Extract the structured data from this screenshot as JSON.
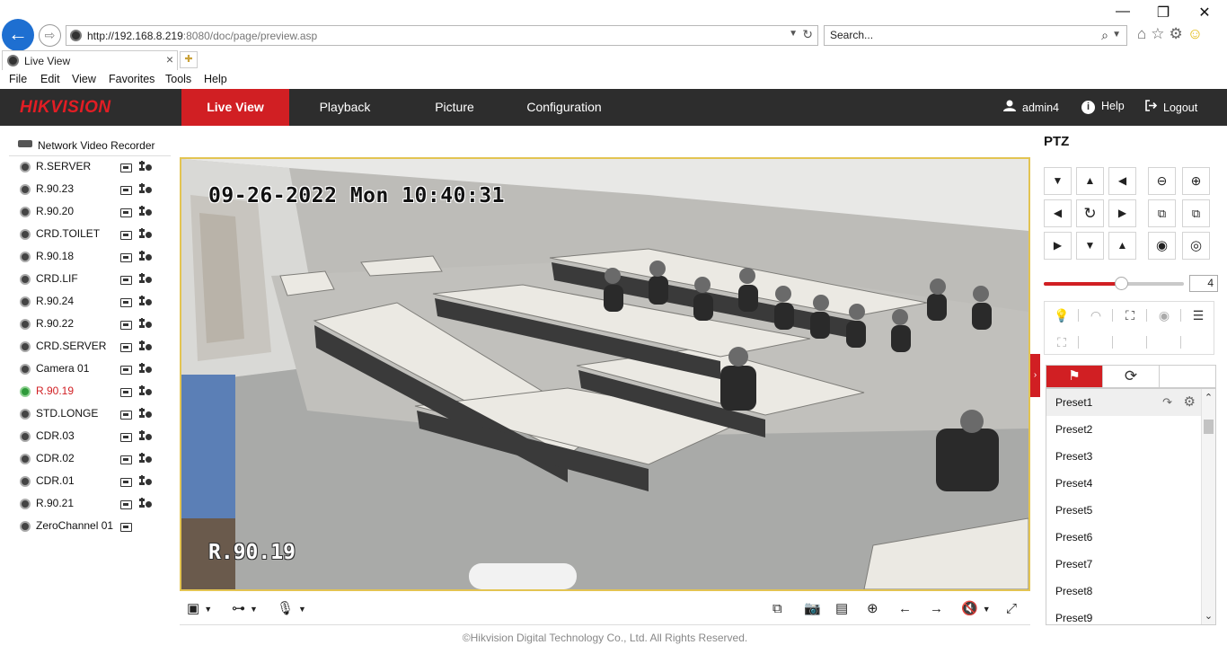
{
  "browser": {
    "window_controls": [
      "—",
      "❐",
      "✕"
    ],
    "url_host": "http://192.168.8.219",
    "url_rest": ":8080/doc/page/preview.asp",
    "search_placeholder": "Search...",
    "tab_title": "Live View",
    "menu": [
      "File",
      "Edit",
      "View",
      "Favorites",
      "Tools",
      "Help"
    ]
  },
  "app": {
    "logo": "HIKVISION",
    "nav": [
      "Live View",
      "Playback",
      "Picture",
      "Configuration"
    ],
    "user": "admin4",
    "help": "Help",
    "logout": "Logout"
  },
  "tree": {
    "root": "Network Video Recorder",
    "channels": [
      {
        "name": "R.SERVER",
        "ptz": true
      },
      {
        "name": "R.90.23",
        "ptz": true
      },
      {
        "name": "R.90.20",
        "ptz": true
      },
      {
        "name": "CRD.TOILET",
        "ptz": true
      },
      {
        "name": "R.90.18",
        "ptz": true
      },
      {
        "name": "CRD.LIF",
        "ptz": true
      },
      {
        "name": "R.90.24",
        "ptz": true
      },
      {
        "name": "R.90.22",
        "ptz": true
      },
      {
        "name": "CRD.SERVER",
        "ptz": true
      },
      {
        "name": "Camera 01",
        "ptz": true
      },
      {
        "name": "R.90.19",
        "ptz": true,
        "selected": true
      },
      {
        "name": "STD.LONGE",
        "ptz": true
      },
      {
        "name": "CDR.03",
        "ptz": true
      },
      {
        "name": "CDR.02",
        "ptz": true
      },
      {
        "name": "CDR.01",
        "ptz": true
      },
      {
        "name": "R.90.21",
        "ptz": true
      },
      {
        "name": "ZeroChannel 01",
        "ptz": false
      }
    ]
  },
  "video": {
    "osd_time": "09-26-2022 Mon 10:40:31",
    "osd_channel": "R.90.19"
  },
  "footer": {
    "copyright": "©Hikvision Digital Technology Co., Ltd. All Rights Reserved."
  },
  "ptz": {
    "title": "PTZ",
    "speed": "4",
    "speed_level": 0.55,
    "presets": [
      "Preset1",
      "Preset2",
      "Preset3",
      "Preset4",
      "Preset5",
      "Preset6",
      "Preset7",
      "Preset8",
      "Preset9"
    ]
  },
  "colors": {
    "accent": "#d11f23",
    "header_bg": "#2d2d2d",
    "video_border": "#e3c452"
  }
}
